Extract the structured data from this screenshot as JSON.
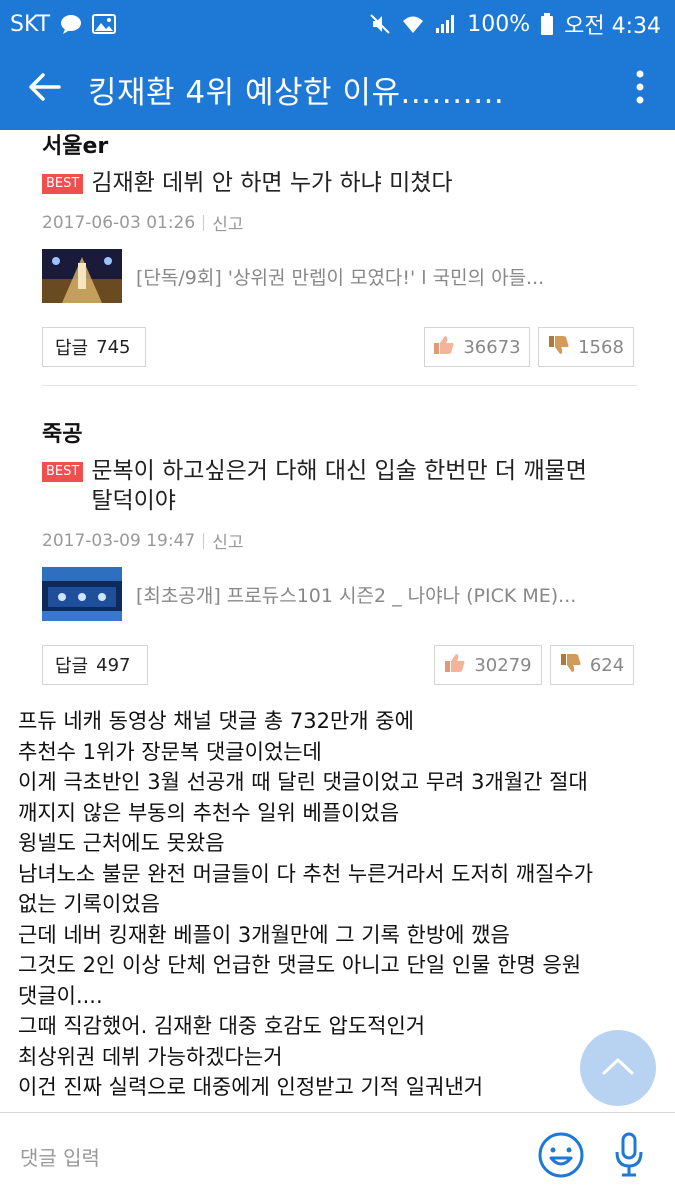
{
  "status_bar": {
    "carrier": "SKT",
    "battery": "100%",
    "time": "오전 4:34"
  },
  "app_bar": {
    "title": "킹재환 4위 예상한 이유.......…",
    "back_icon": "arrow-left-icon",
    "more_icon": "more-vertical-icon"
  },
  "comments": [
    {
      "author": "서울er",
      "badge": "BEST",
      "text": "김재환 데뷔 안 하면 누가 하냐 미쳤다",
      "date": "2017-06-03 01:26",
      "report": "신고",
      "media_title": "[단독/9회] '상위권 만렙이 모였다!' l 국민의 아들...",
      "reply_label": "답글",
      "reply_count": "745",
      "likes": "36673",
      "dislikes": "1568"
    },
    {
      "author": "죽공",
      "badge": "BEST",
      "text_line1": "문복이 하고싶은거 다해 대신 입술 한번만 더 깨물면",
      "text_line2": "탈덕이야",
      "date": "2017-03-09 19:47",
      "report": "신고",
      "media_title": "[최초공개] 프로듀스101 시즌2 _ 나야나 (PICK ME)...",
      "reply_label": "답글",
      "reply_count": "497",
      "likes": "30279",
      "dislikes": "624"
    }
  ],
  "post_lines": [
    "프듀 네캐 동영상 채널 댓글 총 732만개 중에",
    "추천수 1위가 장문복 댓글이었는데",
    "이게 극초반인 3월 선공개 때 달린 댓글이었고 무려 3개월간 절대",
    "깨지지 않은 부동의 추천수 일위 베플이었음",
    "윙넬도 근처에도 못왔음",
    "남녀노소 불문 완전 머글들이 다 추천 누른거라서 도저히 깨질수가",
    "없는 기록이었음",
    "근데 네버 킹재환 베플이 3개월만에 그 기록 한방에 깼음",
    "그것도 2인 이상 단체 언급한 댓글도 아니고 단일 인물 한명 응원",
    "댓글이....",
    "그때 직감했어. 김재환 대중 호감도 압도적인거",
    "최상위권 데뷔 가능하겠다는거",
    "이건 진짜 실력으로 대중에게 인정받고 기적 일궈낸거"
  ],
  "input_bar": {
    "placeholder": "댓글 입력",
    "emoji_icon": "smiley-icon",
    "mic_icon": "microphone-icon"
  },
  "colors": {
    "brand_blue": "#1e78d6",
    "best_red": "#f0504c"
  }
}
